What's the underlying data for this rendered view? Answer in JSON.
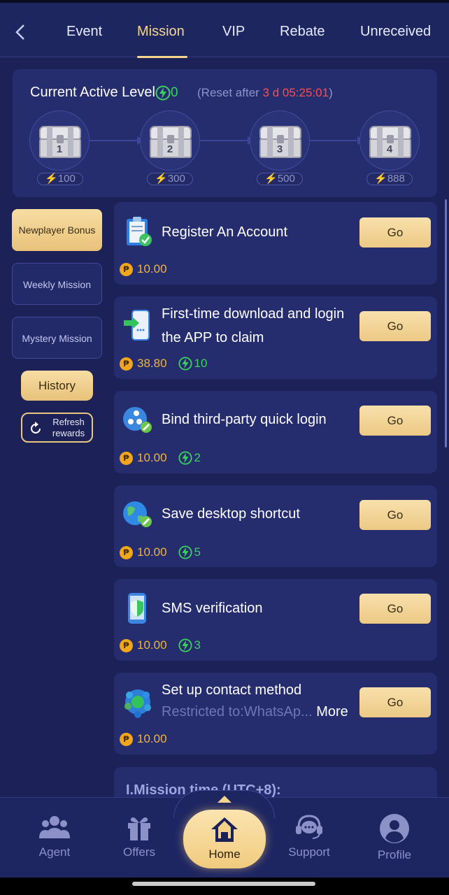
{
  "tabs": [
    {
      "label": "Event",
      "active": false
    },
    {
      "label": "Mission",
      "active": true
    },
    {
      "label": "VIP",
      "active": false
    },
    {
      "label": "Rebate",
      "active": false
    },
    {
      "label": "Unreceived",
      "active": false
    }
  ],
  "level_card": {
    "title": "Current Active Level",
    "active_value": "0",
    "reset_prefix": "(Reset after ",
    "reset_time": "3 d 05:25:01",
    "reset_suffix": ")",
    "chests": [
      {
        "number": "1",
        "energy": "100"
      },
      {
        "number": "2",
        "energy": "300"
      },
      {
        "number": "3",
        "energy": "500"
      },
      {
        "number": "4",
        "energy": "888"
      }
    ]
  },
  "sidebar": {
    "items": [
      {
        "label": "Newplayer Bonus",
        "active": true
      },
      {
        "label": "Weekly Mission",
        "active": false
      },
      {
        "label": "Mystery Mission",
        "active": false
      }
    ],
    "history_label": "History",
    "refresh_label_1": "Refresh",
    "refresh_label_2": "rewards"
  },
  "missions": [
    {
      "title": "Register An Account",
      "coins": "10.00",
      "energy": "",
      "button": "Go",
      "icon": "clipboard-check-icon"
    },
    {
      "title": "First-time download and login the APP to claim",
      "coins": "38.80",
      "energy": "10",
      "button": "Go",
      "icon": "phone-download-icon"
    },
    {
      "title": "Bind third-party quick login",
      "coins": "10.00",
      "energy": "2",
      "button": "Go",
      "icon": "social-link-icon"
    },
    {
      "title": "Save desktop shortcut",
      "coins": "10.00",
      "energy": "5",
      "button": "Go",
      "icon": "globe-link-icon"
    },
    {
      "title": "SMS verification",
      "coins": "10.00",
      "energy": "3",
      "button": "Go",
      "icon": "phone-shield-icon"
    },
    {
      "title": "Set up contact method",
      "subtitle": "Restricted to:WhatsAp...",
      "more": "More",
      "coins": "10.00",
      "energy": "",
      "button": "Go",
      "icon": "contact-apps-icon"
    }
  ],
  "info_heading": "I.Mission time (UTC+8):",
  "bottom_nav": [
    {
      "label": "Agent",
      "icon": "agent-icon"
    },
    {
      "label": "Offers",
      "icon": "gift-icon"
    },
    {
      "label": "Home",
      "icon": "home-icon"
    },
    {
      "label": "Support",
      "icon": "headset-icon"
    },
    {
      "label": "Profile",
      "icon": "profile-icon"
    }
  ],
  "colors": {
    "background": "#1c2258",
    "card": "#252d6e",
    "gold": "#f5d58f",
    "energy_green": "#3ad25a",
    "coin": "#f0a81a",
    "countdown_red": "#ff4d4d"
  }
}
